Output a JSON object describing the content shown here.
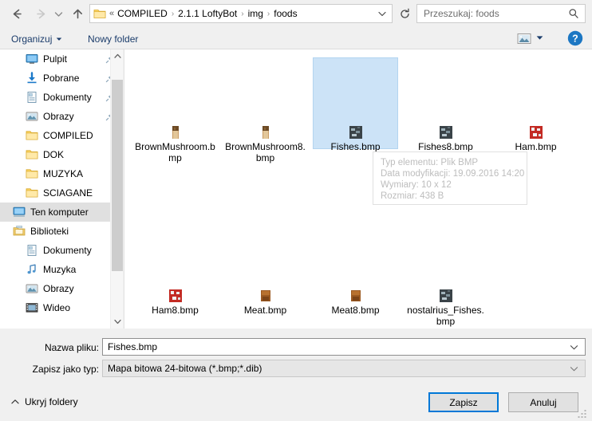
{
  "navbar": {
    "back_icon": "arrow-left-icon",
    "forward_icon": "arrow-right-icon",
    "recent_icon": "chevron-down-icon",
    "up_icon": "arrow-up-icon",
    "address": {
      "folder_icon": "folder-icon",
      "overflow": "«",
      "crumbs": [
        "COMPILED",
        "2.1.1 LoftyBot",
        "img",
        "foods"
      ],
      "separator": "›",
      "dropdown_icon": "chevron-down-icon"
    },
    "refresh_icon": "refresh-icon",
    "search": {
      "placeholder": "Przeszukaj: foods",
      "icon": "search-icon"
    }
  },
  "commandbar": {
    "organize_label": "Organizuj",
    "organize_caret_icon": "caret-down-icon",
    "newfolder_label": "Nowy folder",
    "viewmode_icon": "view-thumbnails-icon",
    "viewmode_caret_icon": "caret-down-icon",
    "help_icon": "help-question-icon"
  },
  "navpane": {
    "items": [
      {
        "label": "Pulpit",
        "icon": "desktop-icon",
        "indent": 1,
        "pinned": true,
        "selected": false
      },
      {
        "label": "Pobrane",
        "icon": "download-icon",
        "indent": 1,
        "pinned": true,
        "selected": false
      },
      {
        "label": "Dokumenty",
        "icon": "document-icon",
        "indent": 1,
        "pinned": true,
        "selected": false
      },
      {
        "label": "Obrazy",
        "icon": "pictures-icon",
        "indent": 1,
        "pinned": true,
        "selected": false
      },
      {
        "label": "COMPILED",
        "icon": "folder-icon",
        "indent": 1,
        "pinned": false,
        "selected": false
      },
      {
        "label": "DOK",
        "icon": "folder-icon",
        "indent": 1,
        "pinned": false,
        "selected": false
      },
      {
        "label": "MUZYKA",
        "icon": "folder-icon",
        "indent": 1,
        "pinned": false,
        "selected": false
      },
      {
        "label": "SCIAGANE",
        "icon": "folder-icon",
        "indent": 1,
        "pinned": false,
        "selected": false
      },
      {
        "label": "Ten komputer",
        "icon": "computer-icon",
        "indent": 0,
        "pinned": false,
        "selected": true
      },
      {
        "label": "Biblioteki",
        "icon": "libraries-icon",
        "indent": 0,
        "pinned": false,
        "selected": false
      },
      {
        "label": "Dokumenty",
        "icon": "document-icon",
        "indent": 1,
        "pinned": false,
        "selected": false
      },
      {
        "label": "Muzyka",
        "icon": "music-icon",
        "indent": 1,
        "pinned": false,
        "selected": false
      },
      {
        "label": "Obrazy",
        "icon": "pictures-icon",
        "indent": 1,
        "pinned": false,
        "selected": false
      },
      {
        "label": "Wideo",
        "icon": "video-icon",
        "indent": 1,
        "pinned": false,
        "selected": false
      }
    ],
    "scrollbar": {
      "up_icon": "chevron-up-icon",
      "down_icon": "chevron-down-icon"
    }
  },
  "filepane": {
    "files": [
      {
        "name": "BrownMushroom.bmp",
        "thumb": "mushroom-thumb",
        "selected": false
      },
      {
        "name": "BrownMushroom8.bmp",
        "thumb": "mushroom-thumb",
        "selected": false
      },
      {
        "name": "Fishes.bmp",
        "thumb": "fish-thumb",
        "selected": true
      },
      {
        "name": "Fishes8.bmp",
        "thumb": "fish-thumb",
        "selected": false
      },
      {
        "name": "Ham.bmp",
        "thumb": "ham-thumb",
        "selected": false
      },
      {
        "name": "Ham8.bmp",
        "thumb": "ham-thumb",
        "selected": false
      },
      {
        "name": "Meat.bmp",
        "thumb": "meat-thumb",
        "selected": false
      },
      {
        "name": "Meat8.bmp",
        "thumb": "meat-thumb",
        "selected": false
      },
      {
        "name": "nostalrius_Fishes.bmp",
        "thumb": "fish-thumb",
        "selected": false
      }
    ]
  },
  "tooltip": {
    "lines": [
      "Typ elementu: Plik BMP",
      "Data modyfikacji: 19.09.2016 14:20",
      "Wymiary: 10 x 12",
      "Rozmiar: 438 B"
    ]
  },
  "form": {
    "filename_label": "Nazwa pliku:",
    "filename_value": "Fishes.bmp",
    "filetype_label": "Zapisz jako typ:",
    "filetype_value": "Mapa bitowa 24-bitowa (*.bmp;*.dib)",
    "combo_caret_icon": "chevron-down-icon",
    "hide_folders_label": "Ukryj foldery",
    "hide_folders_caret_icon": "caret-up-icon",
    "save_label": "Zapisz",
    "cancel_label": "Anuluj",
    "resize_grip_icon": "resize-grip-icon"
  },
  "colors": {
    "accent": "#0078d7",
    "selection_fill": "#cce3f7",
    "selection_border": "#b3d4f0",
    "link_text": "#1b3c6b",
    "tooltip_text": "#bdbdbd"
  }
}
